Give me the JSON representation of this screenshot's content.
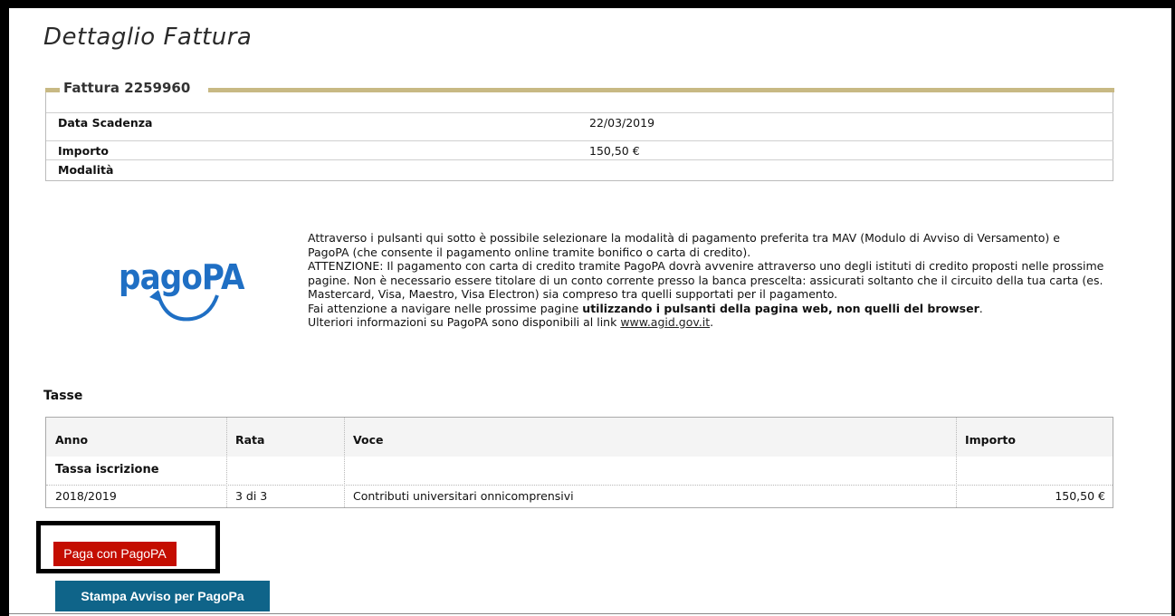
{
  "page": {
    "title": "Dettaglio Fattura"
  },
  "fattura": {
    "legend": "Fattura 2259960",
    "rows": [
      {
        "label": "Data Scadenza",
        "value": "22/03/2019"
      },
      {
        "label": "Importo",
        "value": "150,50 €"
      },
      {
        "label": "Modalità",
        "value": ""
      }
    ]
  },
  "logo": {
    "text": "pagoPA",
    "color": "#1f6fc4"
  },
  "info": {
    "p1": "Attraverso i pulsanti qui sotto è possibile selezionare la modalità di pagamento preferita tra MAV (Modulo di Avviso di Versamento) e PagoPA (che consente il pagamento online tramite bonifico o carta di credito).",
    "p2": "ATTENZIONE: Il pagamento con carta di credito tramite PagoPA dovrà avvenire attraverso uno degli istituti di credito proposti nelle prossime pagine. Non è necessario essere titolare di un conto corrente presso la banca prescelta: assicurati soltanto che il circuito della tua carta (es. Mastercard, Visa, Maestro, Visa Electron) sia compreso tra quelli supportati per il pagamento.",
    "p3_before": "Fai attenzione a navigare nelle prossime pagine ",
    "p3_bold": "utilizzando i pulsanti della pagina web, non quelli del browser",
    "p3_after": ".",
    "p4_before": "Ulteriori informazioni su PagoPA sono disponibili al link ",
    "p4_link": "www.agid.gov.it",
    "p4_after": "."
  },
  "tasse": {
    "title": "Tasse",
    "headers": {
      "anno": "Anno",
      "rata": "Rata",
      "voce": "Voce",
      "importo": "Importo"
    },
    "group": "Tassa iscrizione",
    "rows": [
      {
        "anno": "2018/2019",
        "rata": "3 di 3",
        "voce": "Contributi universitari onnicomprensivi",
        "importo": "150,50 €"
      }
    ]
  },
  "buttons": {
    "pagopa": "Paga con PagoPA",
    "stampa": "Stampa Avviso per PagoPa"
  },
  "colors": {
    "accent_gold": "#c8b984",
    "pagopa_button": "#c40d00",
    "stampa_button": "#0f6489"
  }
}
